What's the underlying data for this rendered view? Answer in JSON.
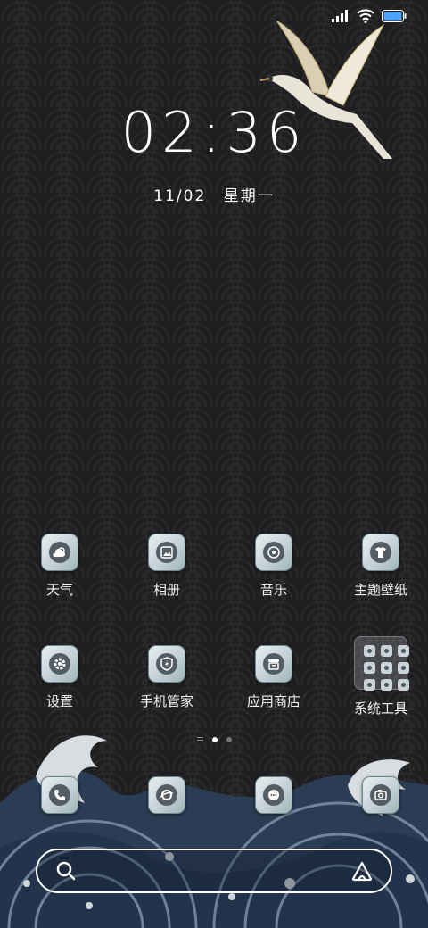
{
  "status": {
    "signal_icon": "signal-icon",
    "wifi_icon": "wifi-icon",
    "battery_icon": "battery-icon",
    "battery_color": "#4aa3ff"
  },
  "lockclock": {
    "time": "02:36",
    "date": "11/02",
    "weekday": "星期一"
  },
  "apps_row1": [
    {
      "label": "天气",
      "icon": "weather-icon"
    },
    {
      "label": "相册",
      "icon": "gallery-icon"
    },
    {
      "label": "音乐",
      "icon": "music-icon"
    },
    {
      "label": "主题壁纸",
      "icon": "theme-icon"
    }
  ],
  "apps_row2": [
    {
      "label": "设置",
      "icon": "settings-icon"
    },
    {
      "label": "手机管家",
      "icon": "security-icon"
    },
    {
      "label": "应用商店",
      "icon": "store-icon"
    },
    {
      "label": "系统工具",
      "icon": "folder-icon"
    }
  ],
  "dock": [
    {
      "icon": "phone-icon"
    },
    {
      "icon": "browser-icon"
    },
    {
      "icon": "messages-icon"
    },
    {
      "icon": "camera-icon"
    }
  ],
  "search": {
    "search_icon": "search-icon",
    "assistant_icon": "assistant-icon"
  },
  "colors": {
    "background": "#1f1f21",
    "wave_blue": "#2a3d55",
    "foam": "#d8dde0"
  }
}
